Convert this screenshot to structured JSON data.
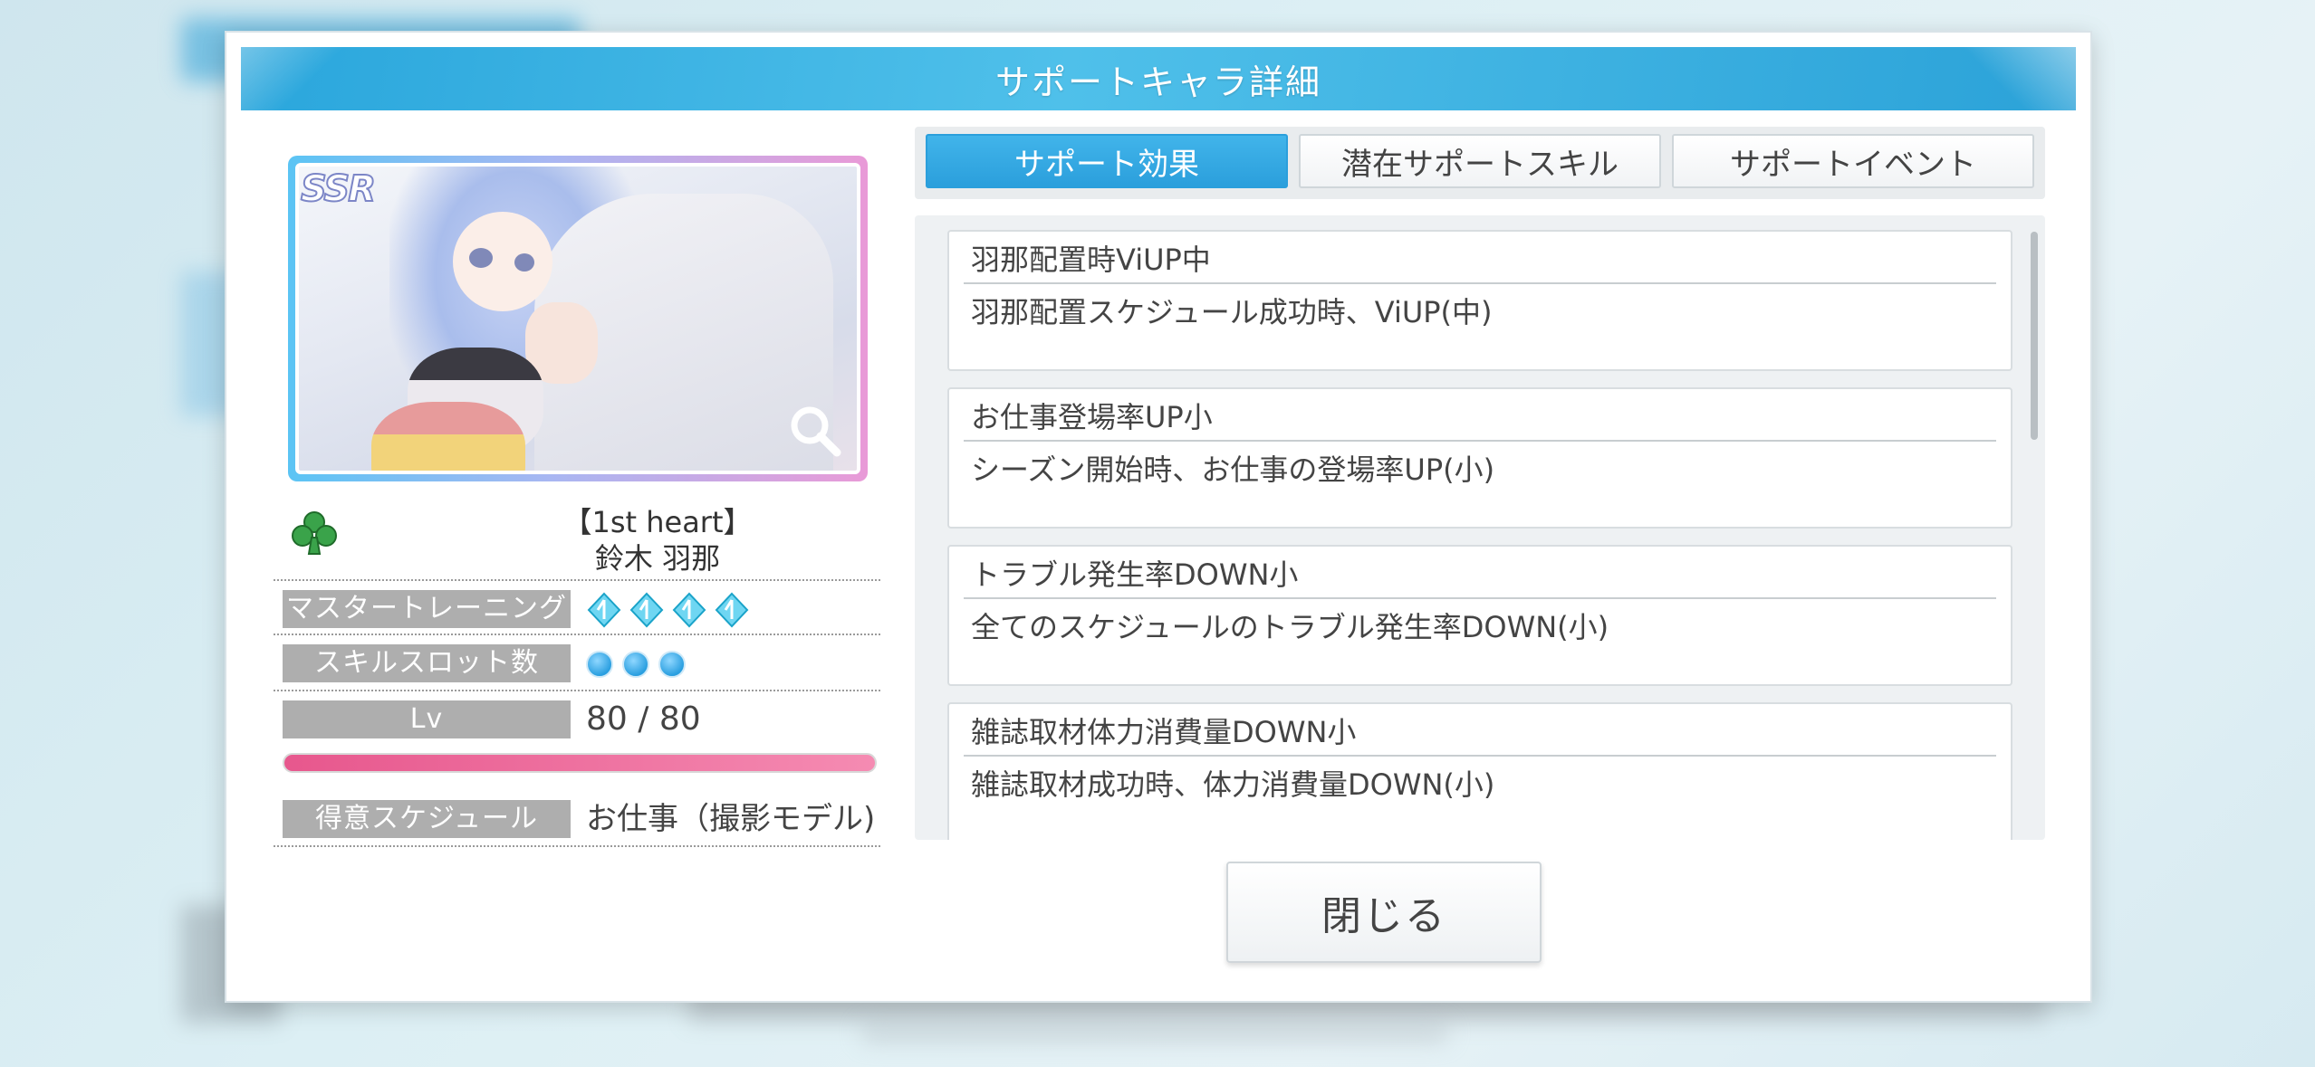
{
  "header": {
    "title": "サポートキャラ詳細"
  },
  "card": {
    "rarity": "SSR",
    "title": "【1st heart】",
    "name": "鈴木 羽那",
    "type_icon": "club-icon",
    "zoom_icon": "magnifier-icon"
  },
  "stats": {
    "master_training": {
      "label": "マスタートレーニング",
      "gems": 4
    },
    "skill_slots": {
      "label": "スキルスロット数",
      "count": 3
    },
    "level": {
      "label": "Lv",
      "value": "80 / 80",
      "progress": 1.0
    },
    "specialty": {
      "label": "得意スケジュール",
      "value": "お仕事（撮影モデル)"
    }
  },
  "tabs": [
    {
      "label": "サポート効果",
      "active": true
    },
    {
      "label": "潜在サポートスキル",
      "active": false
    },
    {
      "label": "サポートイベント",
      "active": false
    }
  ],
  "effects": [
    {
      "name": "羽那配置時ViUP中",
      "desc": "羽那配置スケジュール成功時、ViUP(中)"
    },
    {
      "name": "お仕事登場率UP小",
      "desc": "シーズン開始時、お仕事の登場率UP(小)"
    },
    {
      "name": "トラブル発生率DOWN小",
      "desc": "全てのスケジュールのトラブル発生率DOWN(小)"
    },
    {
      "name": "雑誌取材体力消費量DOWN小",
      "desc": "雑誌取材成功時、体力消費量DOWN(小)"
    }
  ],
  "close_button": {
    "label": "閉じる"
  },
  "colors": {
    "accent": "#2ba2d8",
    "level_bar": "#e7578d",
    "label_bg": "#aeaeae"
  }
}
